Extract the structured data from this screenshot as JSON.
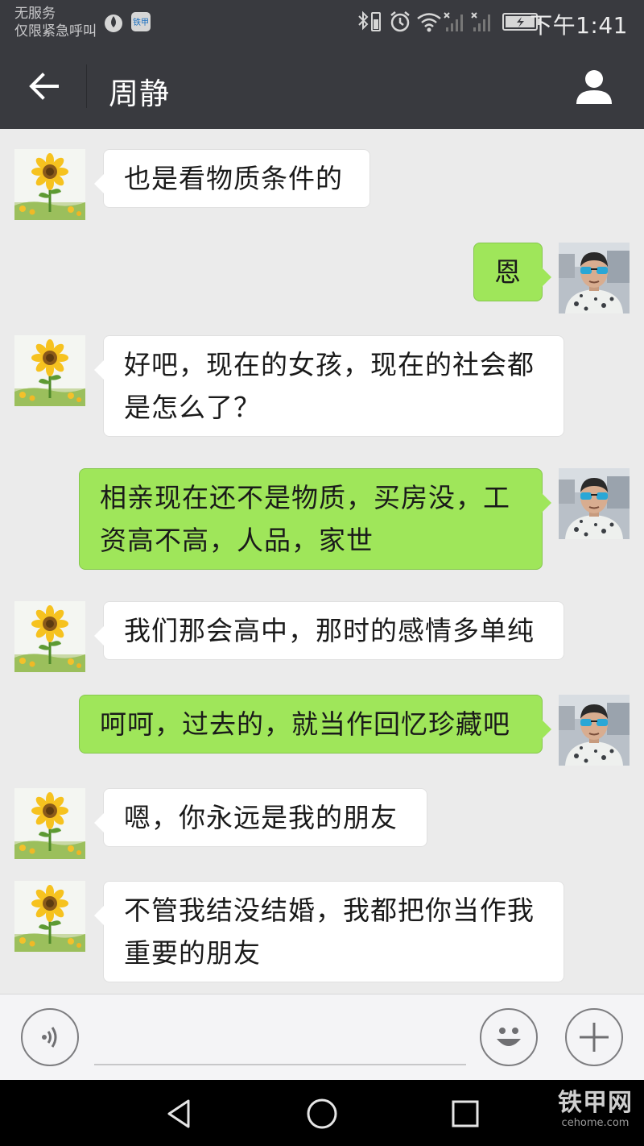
{
  "status_bar": {
    "carrier_line1": "无服务",
    "carrier_line2": "仅限紧急呼叫",
    "app_badge": "铁甲",
    "time": "下午1:41"
  },
  "header": {
    "title": "周静"
  },
  "messages": [
    {
      "side": "in",
      "text": "也是看物质条件的"
    },
    {
      "side": "out",
      "text": "恩"
    },
    {
      "side": "in",
      "text": "好吧，现在的女孩，现在的社会都是怎么了？"
    },
    {
      "side": "out",
      "text": "相亲现在还不是物质，买房没，工资高不高，人品，家世"
    },
    {
      "side": "in",
      "text": "我们那会高中，那时的感情多单纯"
    },
    {
      "side": "out",
      "text": "呵呵，过去的，就当作回忆珍藏吧"
    },
    {
      "side": "in",
      "text": "嗯，你永远是我的朋友"
    },
    {
      "side": "in",
      "text": "不管我结没结婚，我都把你当作我重要的朋友"
    }
  ],
  "input_bar": {
    "placeholder": ""
  },
  "watermark": {
    "main": "铁甲网",
    "sub": "cehome.com"
  },
  "colors": {
    "header_bg": "#393a3f",
    "chat_bg": "#ebebeb",
    "outgoing_bubble": "#9fe65a",
    "incoming_bubble": "#ffffff"
  },
  "icons": {
    "back": "arrow-left-icon",
    "profile": "person-icon",
    "voice": "voice-icon",
    "emoji": "smiley-icon",
    "more": "plus-icon"
  }
}
